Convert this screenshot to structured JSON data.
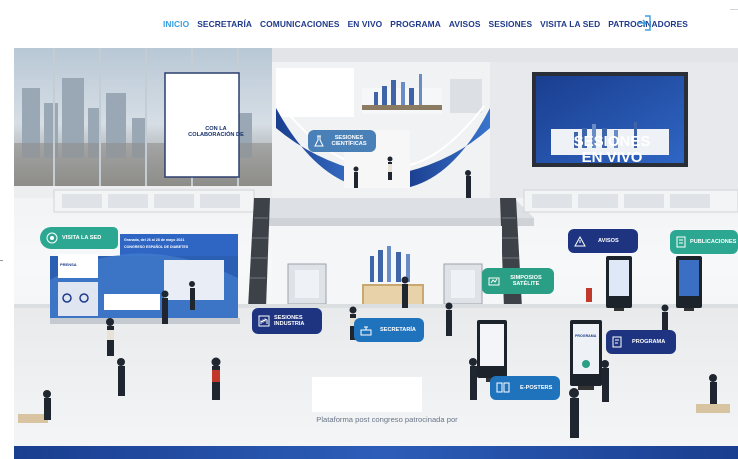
{
  "nav": {
    "items": [
      {
        "label": "INICIO",
        "active": true
      },
      {
        "label": "SECRETARÍA",
        "active": false
      },
      {
        "label": "COMUNICACIONES",
        "active": false
      },
      {
        "label": "EN VIVO",
        "active": false
      },
      {
        "label": "PROGRAMA",
        "active": false
      },
      {
        "label": "AVISOS",
        "active": false
      },
      {
        "label": "SESIONES",
        "active": false
      },
      {
        "label": "VISITA LA SED",
        "active": false
      },
      {
        "label": "PATROCINADORES",
        "active": false
      }
    ],
    "logout_icon": "logout-icon"
  },
  "scene": {
    "collab_text": "CON LA COLABORACIÓN DE",
    "live_screen_text": "SESIONES EN VIVO",
    "sponsor_text": "Plataforma post congreso patrocinada por",
    "booth_sign": "PRENSA",
    "booth_banner": "Granada, del 26 al 28 de mayo 2021",
    "booth_banner_sub": "CONGRESO ESPAÑOL DE DIABETES",
    "kiosk_text": "PROGRAMA"
  },
  "chips": {
    "sesiones_cientificas": "SESIONES CIENTÍFICAS",
    "visita_la_sed": "VISITA LA SED",
    "avisos": "AVISOS",
    "publicaciones": "PUBLICACIONES",
    "simposios_satelite": "SIMPOSIOS SATÉLITE",
    "sesiones_industria": "SESIONES INDUSTRIA",
    "secretaria": "SECRETARÍA",
    "programa": "PROGRAMA",
    "e_posters": "E-POSTERS"
  },
  "colors": {
    "nav_text": "#1f3a8a",
    "nav_active": "#3b9ee0",
    "chip_teal": "#2ca892",
    "chip_navy": "#1e3480",
    "chip_blue": "#1f73bd",
    "brand_blue": "#1a3e8f"
  }
}
